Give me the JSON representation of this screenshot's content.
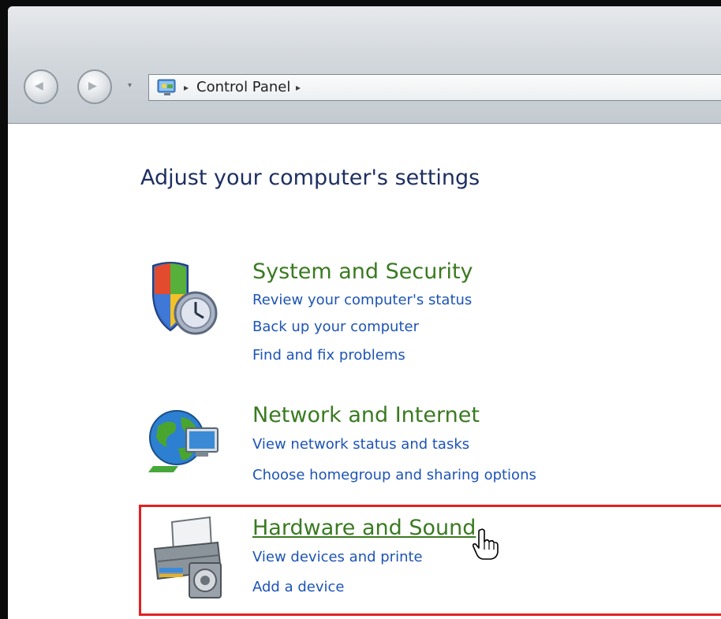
{
  "window": {
    "breadcrumb": {
      "items": [
        "Control Panel"
      ],
      "separator": "▸"
    }
  },
  "main": {
    "title": "Adjust your computer's settings",
    "categories": [
      {
        "title": "System and Security",
        "icon": "shield-clock-icon",
        "links": [
          "Review your computer's status",
          "Back up your computer",
          "Find and fix problems"
        ]
      },
      {
        "title": "Network and Internet",
        "icon": "globe-network-icon",
        "links": [
          "View network status and tasks",
          "Choose homegroup and sharing options"
        ]
      },
      {
        "title": "Hardware and Sound",
        "icon": "printer-speaker-icon",
        "links": [
          "View devices and printe",
          "Add a device"
        ],
        "highlighted": true
      }
    ]
  },
  "colors": {
    "category_title": "#3a7a21",
    "link": "#1d54b5",
    "page_title": "#1d2f62",
    "highlight_border": "#e32020"
  }
}
